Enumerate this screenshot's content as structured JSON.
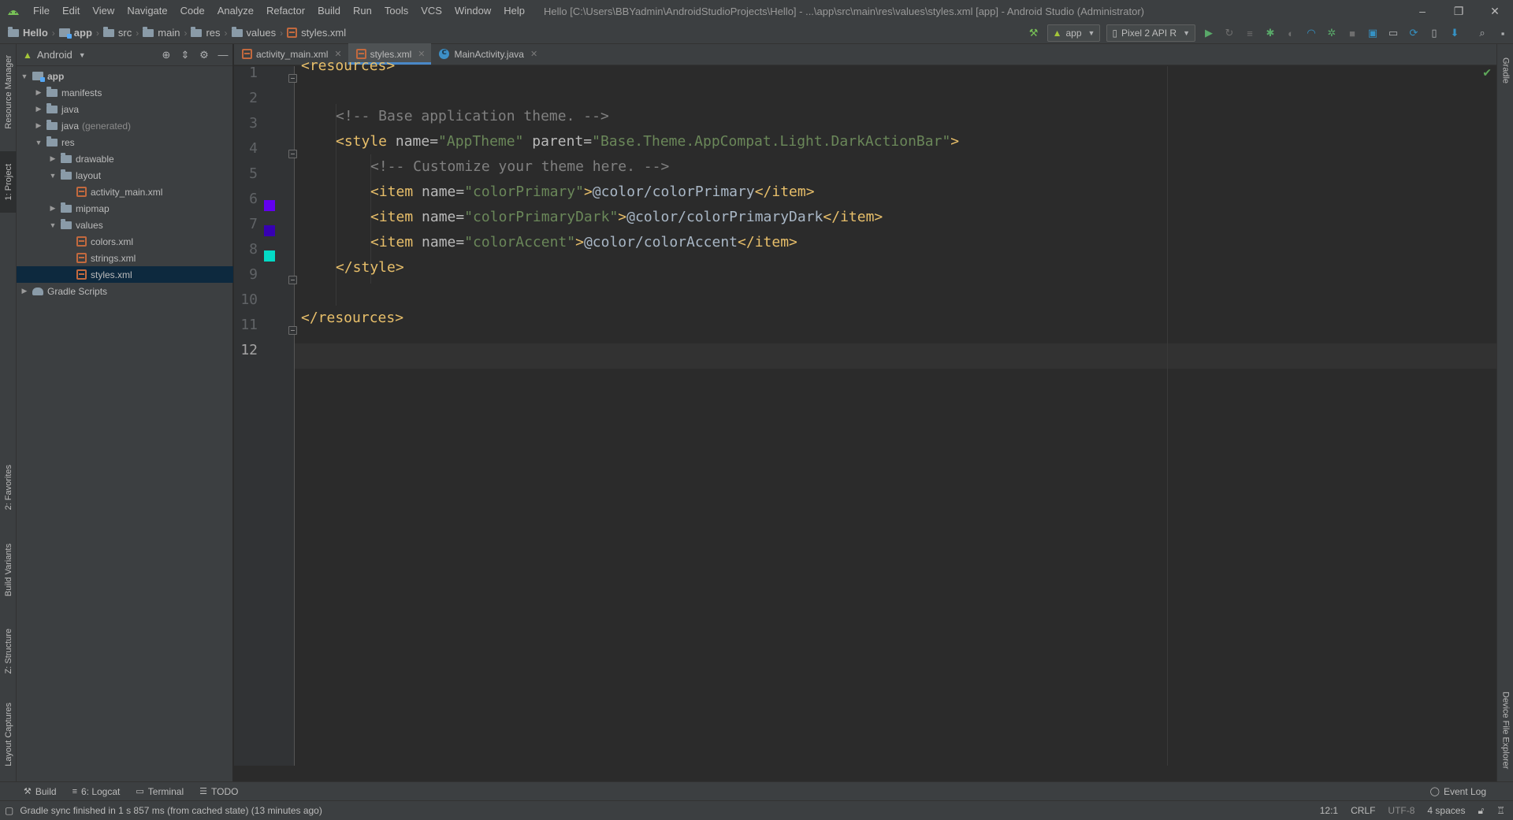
{
  "menu": {
    "items": [
      "File",
      "Edit",
      "View",
      "Navigate",
      "Code",
      "Analyze",
      "Refactor",
      "Build",
      "Run",
      "Tools",
      "VCS",
      "Window",
      "Help"
    ]
  },
  "window": {
    "title": "Hello [C:\\Users\\BBYadmin\\AndroidStudioProjects\\Hello] - ...\\app\\src\\main\\res\\values\\styles.xml [app] - Android Studio (Administrator)",
    "minimize": "–",
    "restore": "❐",
    "close": "✕"
  },
  "breadcrumb": [
    "Hello",
    "app",
    "src",
    "main",
    "res",
    "values",
    "styles.xml"
  ],
  "toolbar": {
    "run_config": "app",
    "device": "Pixel 2 API R"
  },
  "left_strip": {
    "resource_manager": "Resource Manager",
    "project": "1: Project",
    "favorites": "2: Favorites",
    "build_variants": "Build Variants",
    "structure": "Z: Structure",
    "layout_captures": "Layout Captures"
  },
  "right_strip": {
    "gradle": "Gradle",
    "device_file_explorer": "Device File Explorer"
  },
  "project": {
    "view": "Android",
    "tree": {
      "app": "app",
      "manifests": "manifests",
      "java": "java",
      "java_generated": "java",
      "generated_suffix": "(generated)",
      "res": "res",
      "drawable": "drawable",
      "layout": "layout",
      "activity_main": "activity_main.xml",
      "mipmap": "mipmap",
      "values": "values",
      "colors": "colors.xml",
      "strings": "strings.xml",
      "styles": "styles.xml",
      "gradle_scripts": "Gradle Scripts"
    }
  },
  "tabs": [
    {
      "label": "activity_main.xml"
    },
    {
      "label": "styles.xml"
    },
    {
      "label": "MainActivity.java"
    }
  ],
  "editor": {
    "line_numbers": [
      "1",
      "2",
      "3",
      "4",
      "5",
      "6",
      "7",
      "8",
      "9",
      "10",
      "11",
      "12"
    ],
    "swatches": {
      "colorPrimary": "#6200ee",
      "colorPrimaryDark": "#3700b3",
      "colorAccent": "#03dac5"
    },
    "code": {
      "l1_tag": "<resources>",
      "l3_comment": "<!-- Base application theme. -->",
      "l4_open": "<style ",
      "l4_attr1": "name=",
      "l4_val1": "\"AppTheme\"",
      "l4_attr2": " parent=",
      "l4_val2": "\"Base.Theme.AppCompat.Light.DarkActionBar\"",
      "l4_close": ">",
      "l5_comment": "<!-- Customize your theme here. -->",
      "item_open": "<item ",
      "item_attr": "name=",
      "l6_val": "\"colorPrimary\"",
      "l6_text": "@color/colorPrimary",
      "l7_val": "\"colorPrimaryDark\"",
      "l7_text": "@color/colorPrimaryDark",
      "l8_val": "\"colorAccent\"",
      "l8_text": "@color/colorAccent",
      "gt": ">",
      "item_close": "</item>",
      "l9_tag": "</style>",
      "l11_tag": "</resources>"
    }
  },
  "bottom_tools": {
    "build": "Build",
    "logcat": "6: Logcat",
    "terminal": "Terminal",
    "todo": "TODO",
    "event_log": "Event Log"
  },
  "status": {
    "message": "Gradle sync finished in 1 s 857 ms (from cached state) (13 minutes ago)",
    "position": "12:1",
    "line_sep": "CRLF",
    "encoding": "UTF-8",
    "indent": "4 spaces"
  }
}
